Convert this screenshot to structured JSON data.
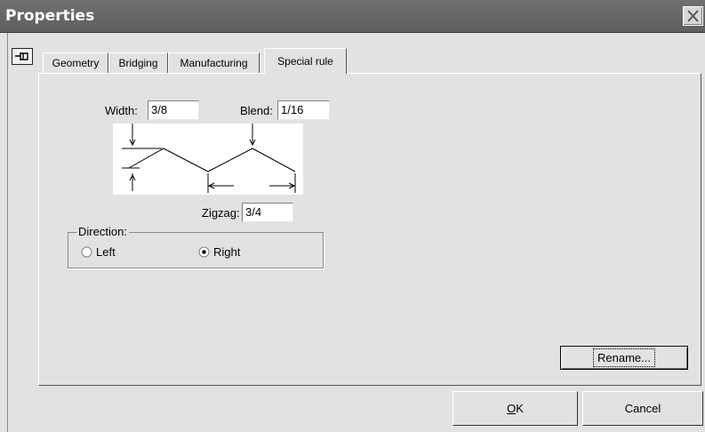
{
  "window": {
    "title": "Properties"
  },
  "tabs": [
    {
      "label": "Geometry",
      "active": false
    },
    {
      "label": "Bridging",
      "active": false
    },
    {
      "label": "Manufacturing",
      "active": false
    },
    {
      "label": "Special rule",
      "active": true
    }
  ],
  "fields": {
    "width": {
      "label": "Width:",
      "value": "3/8"
    },
    "blend": {
      "label": "Blend:",
      "value": "1/16"
    },
    "zigzag": {
      "label": "Zigzag:",
      "value": "3/4"
    }
  },
  "direction": {
    "label": "Direction:",
    "options": [
      {
        "label": "Left",
        "selected": false
      },
      {
        "label": "Right",
        "selected": true
      }
    ]
  },
  "buttons": {
    "rename": "Rename...",
    "ok": "OK",
    "cancel": "Cancel"
  },
  "icons": {
    "close": "close-icon",
    "pin": "pin-icon"
  }
}
